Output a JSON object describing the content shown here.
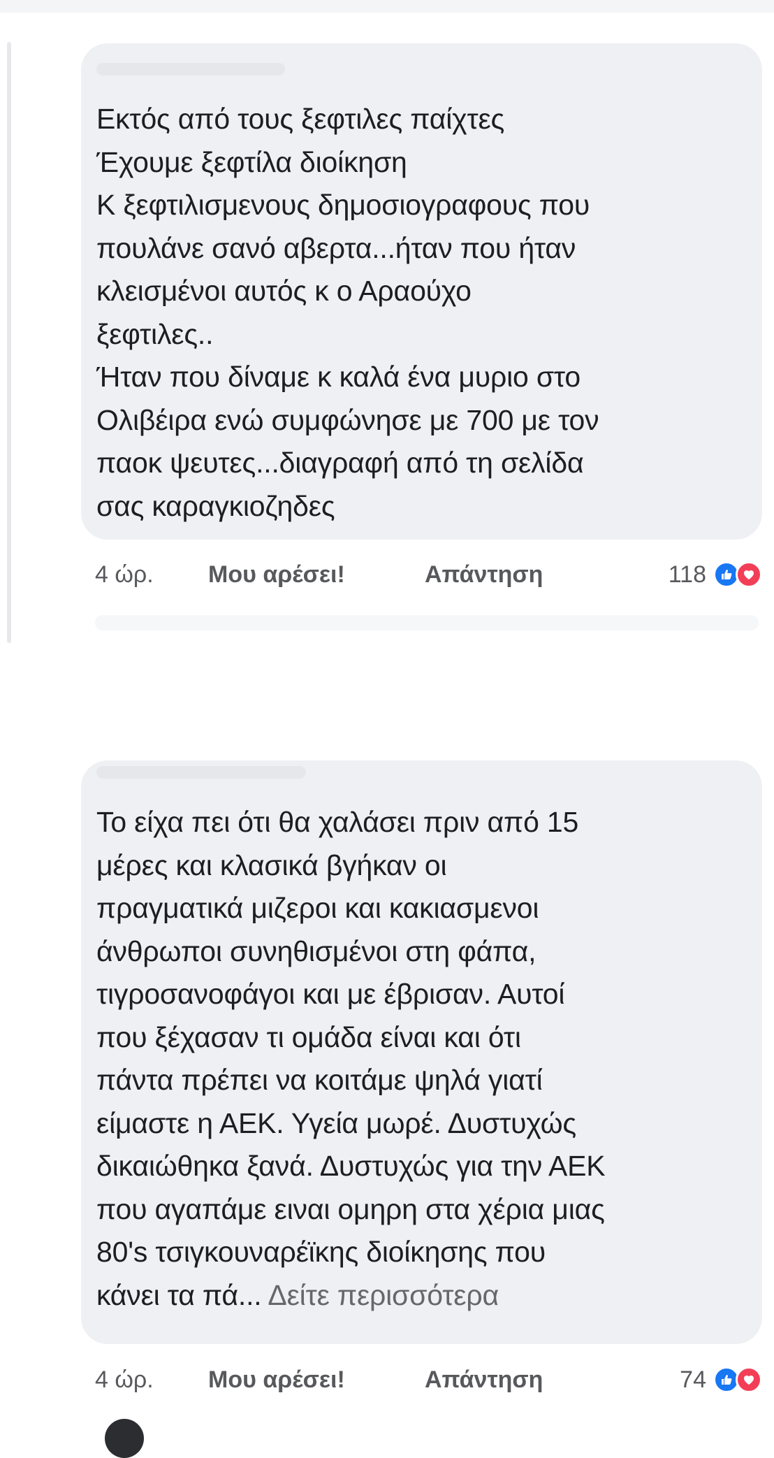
{
  "comments": [
    {
      "lines": [
        "Εκτός από τους ξεφτιλες παίχτες",
        "Έχουμε ξεφτίλα διοίκηση",
        "Κ ξεφτιλισμενους δημοσιογραφους που",
        "πουλάνε σανό αβερτα...ήταν που ήταν",
        "κλεισμένοι αυτός κ ο Αραούχο",
        "ξεφτιλες..",
        "Ήταν που δίναμε κ καλά ένα μυριο στο",
        "Ολιβέιρα ενώ συμφώνησε με 700 με τον",
        "παοκ ψευτες...διαγραφή από τη σελίδα",
        "σας καραγκιοζηδες"
      ],
      "time": "4 ώρ.",
      "like_label": "Μου αρέσει!",
      "reply_label": "Απάντηση",
      "reaction_count": "118"
    },
    {
      "lines": [
        "Το είχα πει ότι θα χαλάσει πριν από 15",
        "μέρες και κλασικά βγήκαν οι",
        "πραγματικά μιζεροι και κακιασμενοι",
        "άνθρωποι συνηθισμένοι στη φάπα,",
        "τιγροσανοφάγοι και με έβρισαν. Αυτοί",
        "που ξέχασαν τι ομάδα είναι και ότι",
        "πάντα πρέπει να κοιτάμε ψηλά γιατί",
        "είμαστε η ΑΕΚ. Υγεία μωρέ. Δυστυχώς",
        "δικαιώθηκα ξανά. Δυστυχώς για την ΑΕΚ",
        "που αγαπάμε ειναι ομηρη στα χέρια μιας",
        "80's τσιγκουναρέϊκης διοίκησης που"
      ],
      "last_line_text": "κάνει τα πά...",
      "see_more_label": "Δείτε περισσότερα",
      "time": "4 ώρ.",
      "like_label": "Μου αρέσει!",
      "reply_label": "Απάντηση",
      "reaction_count": "74"
    }
  ],
  "colors": {
    "bubble": "#eef0f3",
    "text": "#1c1e21",
    "meta_text": "#58595c",
    "like_blue": "#1877f2",
    "love_red": "#f33e58"
  },
  "icons": [
    "like-reaction-icon",
    "love-reaction-icon"
  ]
}
